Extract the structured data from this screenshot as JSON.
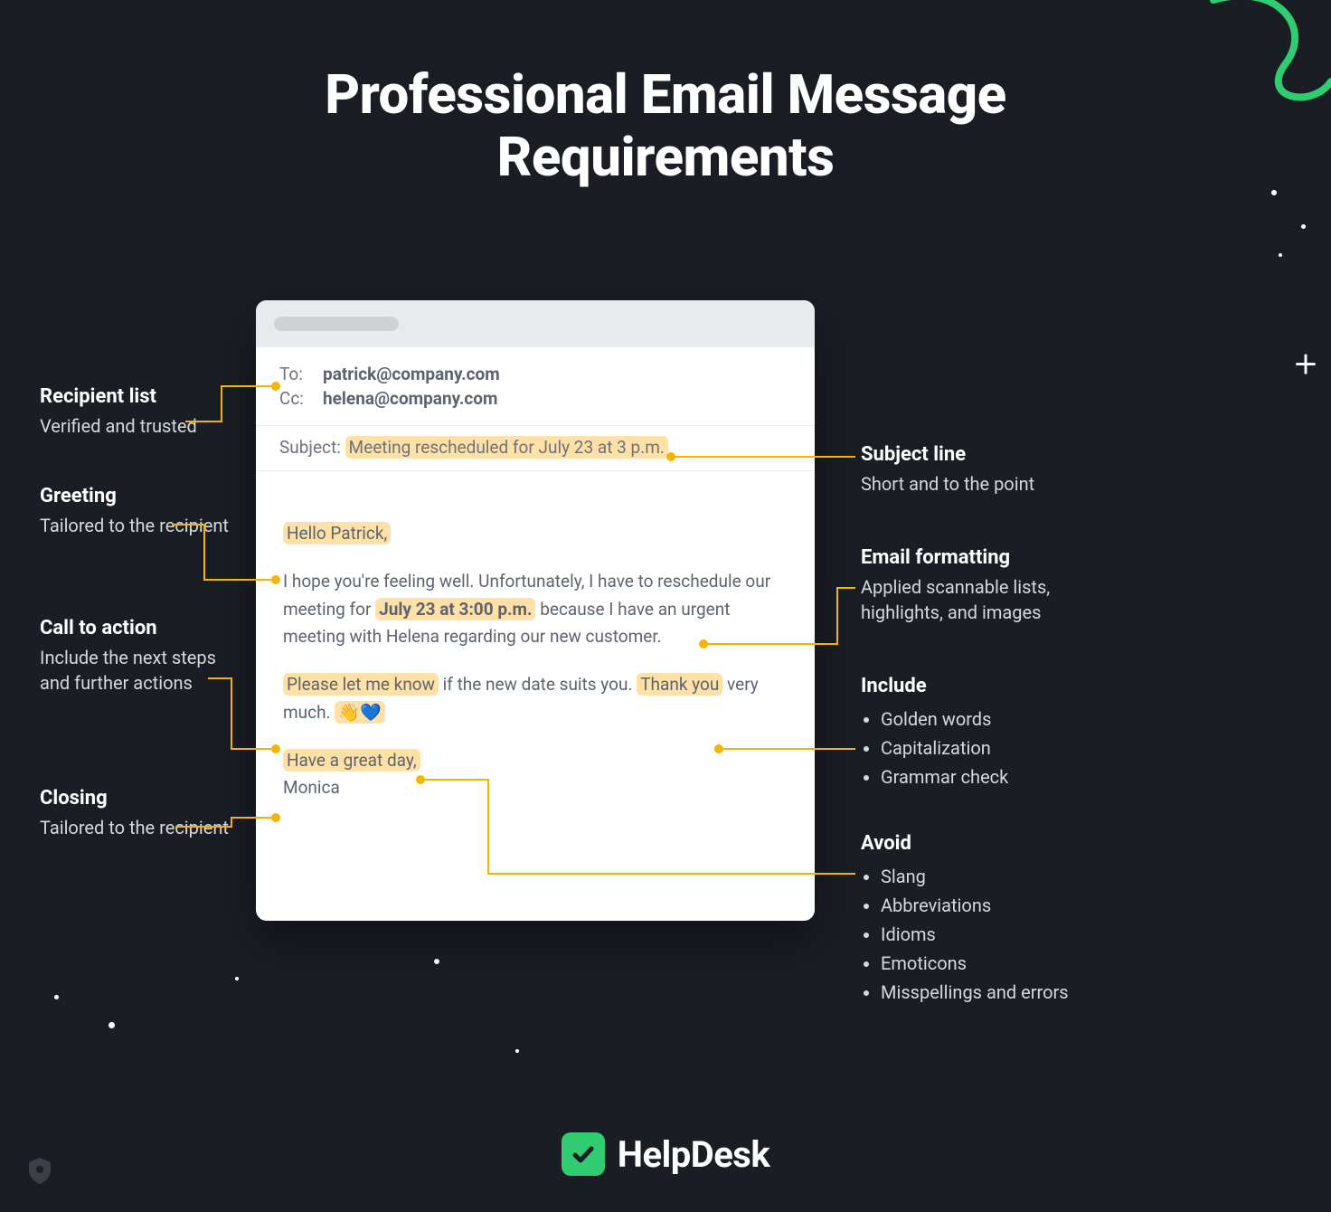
{
  "title": "Professional Email Message\nRequirements",
  "email": {
    "to_label": "To:",
    "to_value": "patrick@company.com",
    "cc_label": "Cc:",
    "cc_value": "helena@company.com",
    "subject_label": "Subject:",
    "subject_value": "Meeting rescheduled for July 23 at 3 p.m.",
    "greeting": "Hello Patrick,",
    "para_a": "I hope you're feeling well. Unfortunately, I have to reschedule our meeting for ",
    "para_bold": "July 23 at 3:00 p.m.",
    "para_b": " because I have an urgent meeting with Helena regarding our new customer.",
    "cta_a": "Please let me know",
    "cta_mid": " if the new date suits you. ",
    "cta_b": "Thank you",
    "cta_c": " very much. ",
    "emoji": "👋💙",
    "closing": "Have a great day,",
    "signature": "Monica"
  },
  "left": {
    "recipient_h": "Recipient list",
    "recipient_s": "Verified and trusted",
    "greeting_h": "Greeting",
    "greeting_s": "Tailored to the recipient",
    "cta_h": "Call to action",
    "cta_s": "Include the next steps and further actions",
    "closing_h": "Closing",
    "closing_s": "Tailored to the recipient"
  },
  "right": {
    "subject_h": "Subject line",
    "subject_s": "Short and to the point",
    "format_h": "Email formatting",
    "format_s": "Applied scannable lists, highlights, and images",
    "include_h": "Include",
    "include_items": [
      "Golden words",
      "Capitalization",
      "Grammar check"
    ],
    "avoid_h": "Avoid",
    "avoid_items": [
      "Slang",
      "Abbreviations",
      "Idioms",
      "Emoticons",
      "Misspellings and errors"
    ]
  },
  "brand": "HelpDesk"
}
